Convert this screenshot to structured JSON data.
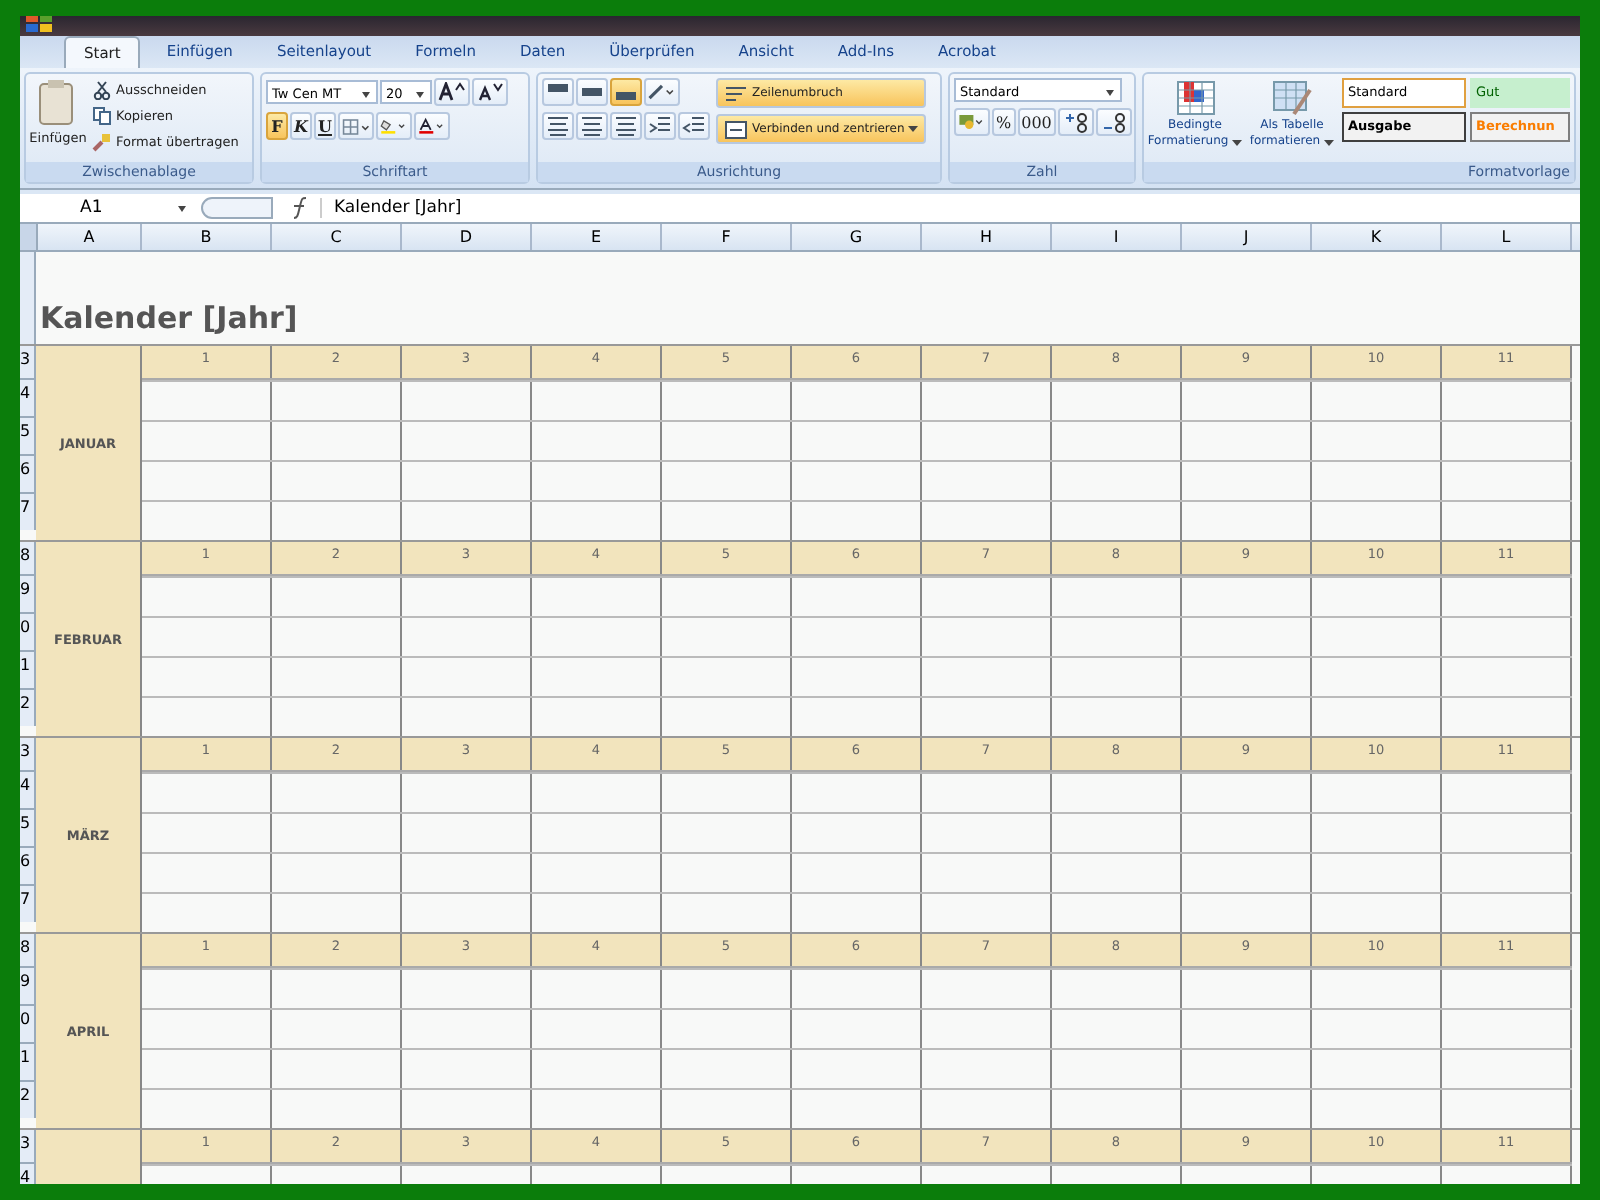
{
  "tabs": [
    {
      "label": "Start",
      "selected": true
    },
    {
      "label": "Einfügen",
      "selected": false
    },
    {
      "label": "Seitenlayout",
      "selected": false
    },
    {
      "label": "Formeln",
      "selected": false
    },
    {
      "label": "Daten",
      "selected": false
    },
    {
      "label": "Überprüfen",
      "selected": false
    },
    {
      "label": "Ansicht",
      "selected": false
    },
    {
      "label": "Add-Ins",
      "selected": false
    },
    {
      "label": "Acrobat",
      "selected": false
    }
  ],
  "clipboard": {
    "paste": "Einfügen",
    "items": [
      "Ausschneiden",
      "Kopieren",
      "Format übertragen"
    ],
    "label": "Zwischenablage"
  },
  "font": {
    "name": "Tw Cen MT",
    "size": "20",
    "bold": "F",
    "italic": "K",
    "underline": "U",
    "bold_on": true,
    "label": "Schriftart"
  },
  "alignment": {
    "wrap": {
      "label": "Zeilenumbruch",
      "on": true
    },
    "merge": {
      "label": "Verbinden und zentrieren",
      "on": true
    },
    "bottom_on": true,
    "label": "Ausrichtung"
  },
  "number": {
    "format": "Standard",
    "percent": "%",
    "thousands": "000",
    "label": "Zahl"
  },
  "styles": {
    "conditional": [
      "Bedingte",
      "Formatierung"
    ],
    "as_table": [
      "Als Tabelle",
      "formatieren"
    ],
    "cells": [
      {
        "label": "Standard",
        "kind": "normal"
      },
      {
        "label": "Gut",
        "kind": "good"
      },
      {
        "label": "Ausgabe",
        "kind": "output"
      },
      {
        "label": "Berechnun",
        "kind": "calc"
      }
    ],
    "label": "Formatvorlage"
  },
  "formula_bar": {
    "name_box": "A1",
    "formula": "Kalender [Jahr]"
  },
  "columns": [
    "A",
    "B",
    "C",
    "D",
    "E",
    "F",
    "G",
    "H",
    "I",
    "J",
    "K",
    "L"
  ],
  "title": "Kalender [Jahr]",
  "blocks": [
    {
      "month": "JANUAR",
      "rows": [
        "3",
        "4",
        "5",
        "6",
        "7"
      ],
      "days": [
        "1",
        "2",
        "3",
        "4",
        "5",
        "6",
        "7",
        "8",
        "9",
        "10",
        "11"
      ]
    },
    {
      "month": "FEBRUAR",
      "rows": [
        "8",
        "9",
        "0",
        "1",
        "2"
      ],
      "days": [
        "1",
        "2",
        "3",
        "4",
        "5",
        "6",
        "7",
        "8",
        "9",
        "10",
        "11"
      ]
    },
    {
      "month": "MÄRZ",
      "rows": [
        "3",
        "4",
        "5",
        "6",
        "7"
      ],
      "days": [
        "1",
        "2",
        "3",
        "4",
        "5",
        "6",
        "7",
        "8",
        "9",
        "10",
        "11"
      ]
    },
    {
      "month": "APRIL",
      "rows": [
        "8",
        "9",
        "0",
        "1",
        "2"
      ],
      "days": [
        "1",
        "2",
        "3",
        "4",
        "5",
        "6",
        "7",
        "8",
        "9",
        "10",
        "11"
      ]
    },
    {
      "rows": [
        "3",
        "4"
      ],
      "days": [
        "1",
        "2",
        "3",
        "4",
        "5",
        "6",
        "7",
        "8",
        "9",
        "10",
        "11"
      ]
    }
  ]
}
